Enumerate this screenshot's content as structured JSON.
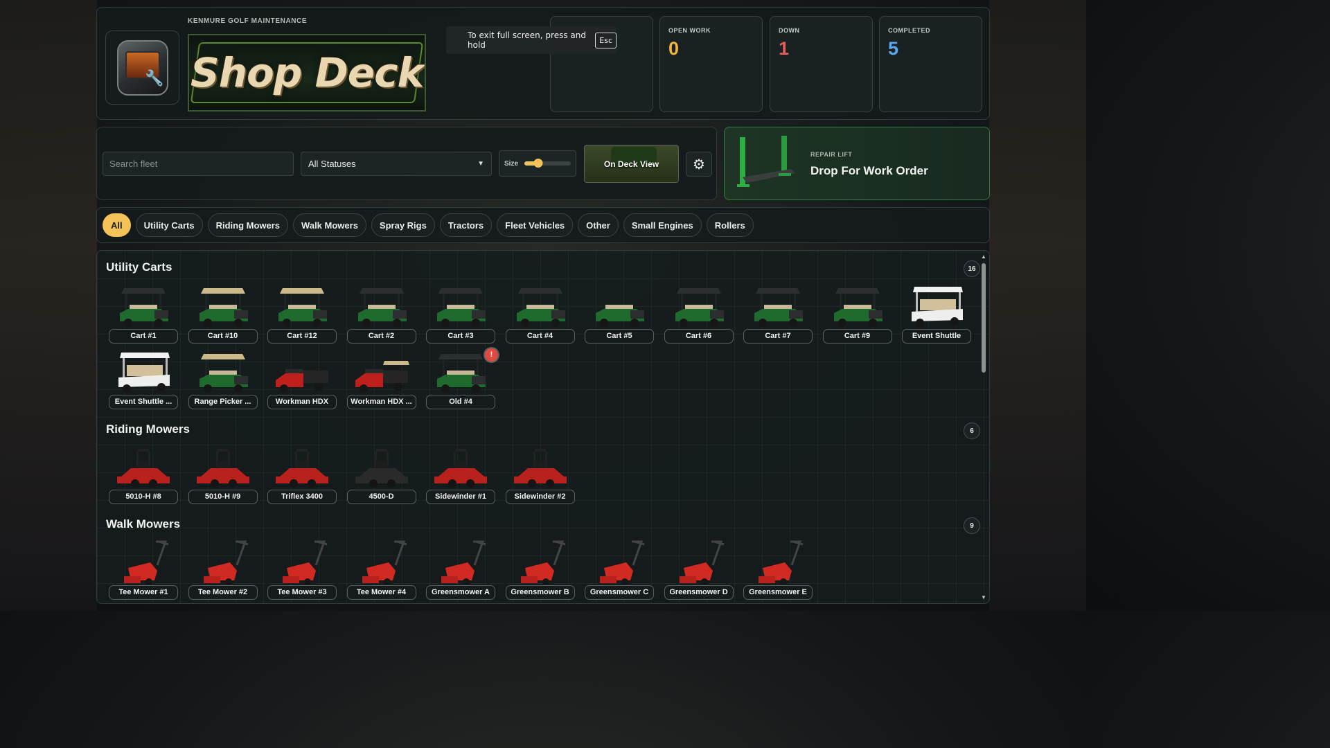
{
  "brand": {
    "kicker": "KENMURE GOLF MAINTENANCE",
    "title": "Shop Deck"
  },
  "fullscreen_notice": {
    "text": "To exit full screen, press and hold",
    "key": "Esc"
  },
  "stats": [
    {
      "label": "",
      "value": "",
      "color": "#3ecf6e"
    },
    {
      "label": "OPEN WORK",
      "value": "0",
      "color": "#f3b63d"
    },
    {
      "label": "DOWN",
      "value": "1",
      "color": "#ec5b5b"
    },
    {
      "label": "COMPLETED",
      "value": "5",
      "color": "#5aa8f0"
    }
  ],
  "controls": {
    "search_placeholder": "Search fleet",
    "status_selected": "All Statuses",
    "size_label": "Size",
    "size_level": 0.3,
    "on_deck_label": "On Deck View",
    "settings_icon": "gear-icon"
  },
  "repair_lift": {
    "kicker": "REPAIR LIFT",
    "title": "Drop For Work Order",
    "accent": "#2f9a4a"
  },
  "categories": [
    {
      "label": "All",
      "active": true
    },
    {
      "label": "Utility Carts"
    },
    {
      "label": "Riding Mowers"
    },
    {
      "label": "Walk Mowers"
    },
    {
      "label": "Spray Rigs"
    },
    {
      "label": "Tractors"
    },
    {
      "label": "Fleet Vehicles"
    },
    {
      "label": "Other"
    },
    {
      "label": "Small Engines"
    },
    {
      "label": "Rollers"
    }
  ],
  "sections": [
    {
      "title": "Utility Carts",
      "count": "16",
      "items": [
        {
          "name": "Cart #1",
          "kind": "cart",
          "roof": "dark"
        },
        {
          "name": "Cart #10",
          "kind": "cart",
          "roof": "tan"
        },
        {
          "name": "Cart #12",
          "kind": "cart",
          "roof": "tan"
        },
        {
          "name": "Cart #2",
          "kind": "cart",
          "roof": "dark"
        },
        {
          "name": "Cart #3",
          "kind": "cart",
          "roof": "dark"
        },
        {
          "name": "Cart #4",
          "kind": "cart",
          "roof": "dark"
        },
        {
          "name": "Cart #5",
          "kind": "cart",
          "roof": "none"
        },
        {
          "name": "Cart #6",
          "kind": "cart",
          "roof": "dark"
        },
        {
          "name": "Cart #7",
          "kind": "cart",
          "roof": "dark"
        },
        {
          "name": "Cart #9",
          "kind": "cart",
          "roof": "dark"
        },
        {
          "name": "Event Shuttle",
          "kind": "shuttle"
        },
        {
          "name": "Event Shuttle ...",
          "kind": "shuttle"
        },
        {
          "name": "Range Picker ...",
          "kind": "cart",
          "roof": "tan"
        },
        {
          "name": "Workman HDX",
          "kind": "workman"
        },
        {
          "name": "Workman HDX ...",
          "kind": "workman",
          "roof": "tan"
        },
        {
          "name": "Old #4",
          "kind": "cart",
          "roof": "dark",
          "alert": "!"
        }
      ]
    },
    {
      "title": "Riding Mowers",
      "count": "6",
      "items": [
        {
          "name": "5010-H #8",
          "kind": "rider",
          "color": "#b8211c"
        },
        {
          "name": "5010-H #9",
          "kind": "rider",
          "color": "#b8211c"
        },
        {
          "name": "Triflex 3400",
          "kind": "rider",
          "color": "#b8211c"
        },
        {
          "name": "4500-D",
          "kind": "rider",
          "color": "#2a2a2a"
        },
        {
          "name": "Sidewinder #1",
          "kind": "rider",
          "color": "#b8211c"
        },
        {
          "name": "Sidewinder #2",
          "kind": "rider",
          "color": "#b8211c"
        }
      ]
    },
    {
      "title": "Walk Mowers",
      "count": "9",
      "items": [
        {
          "name": "Tee Mower #1",
          "kind": "walk"
        },
        {
          "name": "Tee Mower #2",
          "kind": "walk"
        },
        {
          "name": "Tee Mower #3",
          "kind": "walk"
        },
        {
          "name": "Tee Mower #4",
          "kind": "walk"
        },
        {
          "name": "Greensmower A",
          "kind": "walk"
        },
        {
          "name": "Greensmower B",
          "kind": "walk"
        },
        {
          "name": "Greensmower C",
          "kind": "walk"
        },
        {
          "name": "Greensmower D",
          "kind": "walk"
        },
        {
          "name": "Greensmower E",
          "kind": "walk"
        }
      ]
    }
  ]
}
